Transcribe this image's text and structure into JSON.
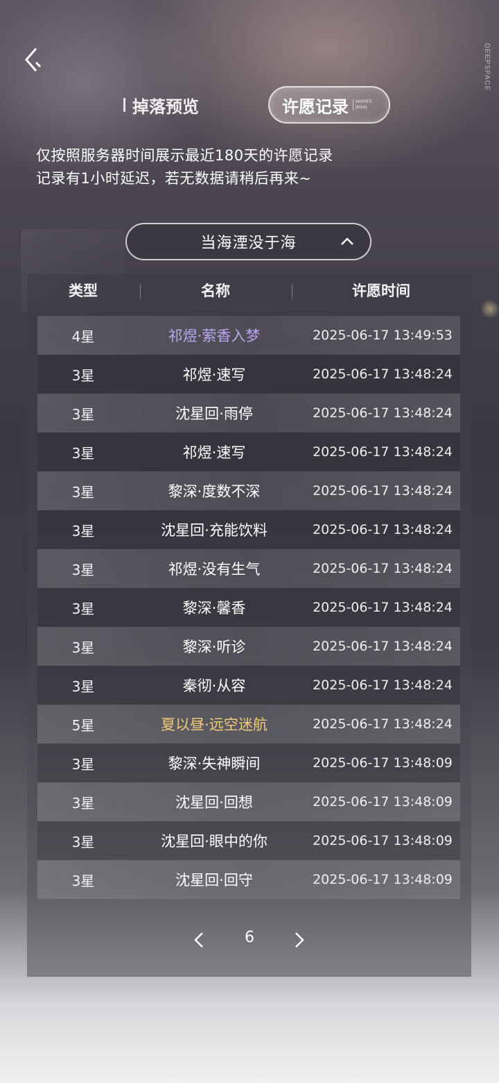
{
  "brand": {
    "vertical_text": "DEEPSPACE"
  },
  "tabs": {
    "drop_preview": "掉落预览",
    "wish_record": "许愿记录",
    "wish_record_mini_1": "WISHES",
    "wish_record_mini_2": "[Mine]"
  },
  "notice": {
    "line1": "仅按照服务器时间展示最近180天的许愿记录",
    "line2": "记录有1小时延迟，若无数据请稍后再来~"
  },
  "pool_select": {
    "selected": "当海湮没于海"
  },
  "table": {
    "headers": {
      "type": "类型",
      "name": "名称",
      "time": "许愿时间"
    },
    "rows": [
      {
        "type": "4星",
        "name": "祁煜·萦香入梦",
        "time": "2025-06-17 13:49:53",
        "rarity": "4"
      },
      {
        "type": "3星",
        "name": "祁煜·速写",
        "time": "2025-06-17 13:48:24",
        "rarity": "3"
      },
      {
        "type": "3星",
        "name": "沈星回·雨停",
        "time": "2025-06-17 13:48:24",
        "rarity": "3"
      },
      {
        "type": "3星",
        "name": "祁煜·速写",
        "time": "2025-06-17 13:48:24",
        "rarity": "3"
      },
      {
        "type": "3星",
        "name": "黎深·度数不深",
        "time": "2025-06-17 13:48:24",
        "rarity": "3"
      },
      {
        "type": "3星",
        "name": "沈星回·充能饮料",
        "time": "2025-06-17 13:48:24",
        "rarity": "3"
      },
      {
        "type": "3星",
        "name": "祁煜·没有生气",
        "time": "2025-06-17 13:48:24",
        "rarity": "3"
      },
      {
        "type": "3星",
        "name": "黎深·馨香",
        "time": "2025-06-17 13:48:24",
        "rarity": "3"
      },
      {
        "type": "3星",
        "name": "黎深·听诊",
        "time": "2025-06-17 13:48:24",
        "rarity": "3"
      },
      {
        "type": "3星",
        "name": "秦彻·从容",
        "time": "2025-06-17 13:48:24",
        "rarity": "3"
      },
      {
        "type": "5星",
        "name": "夏以昼·远空迷航",
        "time": "2025-06-17 13:48:24",
        "rarity": "5"
      },
      {
        "type": "3星",
        "name": "黎深·失神瞬间",
        "time": "2025-06-17 13:48:09",
        "rarity": "3"
      },
      {
        "type": "3星",
        "name": "沈星回·回想",
        "time": "2025-06-17 13:48:09",
        "rarity": "3"
      },
      {
        "type": "3星",
        "name": "沈星回·眼中的你",
        "time": "2025-06-17 13:48:09",
        "rarity": "3"
      },
      {
        "type": "3星",
        "name": "沈星回·回守",
        "time": "2025-06-17 13:48:09",
        "rarity": "3"
      }
    ]
  },
  "rarity_colors": {
    "3": "#ffffff",
    "4": "#b9a6f0",
    "5": "#f0cc7a"
  },
  "pager": {
    "page": "6"
  },
  "icons": {
    "back": "back-arrow-icon",
    "chevron_up": "chevron-up-icon",
    "prev": "chevron-left-icon",
    "next": "chevron-right-icon"
  }
}
